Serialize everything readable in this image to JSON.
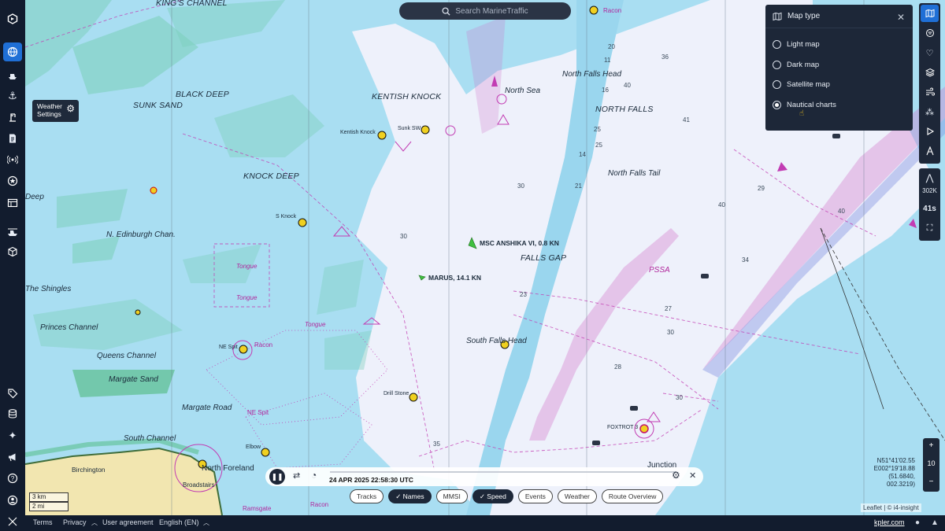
{
  "search": {
    "placeholder": "Search MarineTraffic"
  },
  "weather": {
    "line1": "Weather",
    "line2": "Settings"
  },
  "map_type": {
    "title": "Map type",
    "options": [
      {
        "label": "Light map",
        "selected": false
      },
      {
        "label": "Dark map",
        "selected": false
      },
      {
        "label": "Satellite map",
        "selected": false
      },
      {
        "label": "Nautical charts",
        "selected": true
      }
    ]
  },
  "map_labels": {
    "kings_channel": "KING'S CHANNEL",
    "black_deep": "BLACK DEEP",
    "sunk_sand": "SUNK SAND",
    "kentish_knock": "KENTISH KNOCK",
    "knock_deep": "KNOCK DEEP",
    "edinburgh": "N. Edinburgh Chan.",
    "shingles": "The Shingles",
    "princes": "Princes Channel",
    "queens": "Queens Channel",
    "margate_sand": "Margate Sand",
    "margate_road": "Margate Road",
    "south_channel": "South Channel",
    "birchington": "Birchington",
    "north_foreland": "North Foreland",
    "north_sea": "North Sea",
    "nf_head": "North Falls Head",
    "north_falls": "NORTH FALLS",
    "nf_tail": "North Falls Tail",
    "falls_gap": "FALLS GAP",
    "sf_head": "South Falls Head",
    "pssa": "PSSA",
    "junction": "Junction",
    "deep": "Deep",
    "kentish_knock_buoy": "Kentish Knock",
    "sunk_sw": "Sunk SW",
    "s_knock": "S Knock",
    "ne_spit": "NE Spit",
    "drill_stone": "Drill Stone",
    "elbow": "Elbow",
    "racon": "Racon",
    "tongue": "Tongue",
    "foxtrot": "FOXTROT 3",
    "ramsgate": "Ramsgate",
    "broadstairs": "Broadstairs"
  },
  "vessels": [
    {
      "name": "MSC ANSHIKA VI, 0.8 KN",
      "color": "#3fbf3f"
    },
    {
      "name": "MARUS, 14.1 KN",
      "color": "#3fbf3f"
    }
  ],
  "depths": [
    "30",
    "30",
    "41",
    "40",
    "40",
    "29",
    "34",
    "35",
    "36",
    "27",
    "28",
    "25",
    "23",
    "20",
    "16",
    "14",
    "11",
    "21",
    "25",
    "30",
    "30",
    "40"
  ],
  "right_toolbar": {
    "count": "302K",
    "timer": "41s"
  },
  "zoom": {
    "plus": "+",
    "level": "10",
    "minus": "−"
  },
  "coords": {
    "lat": "N51°41'02.55",
    "lon": "E002°19'18.88",
    "decimal": "(51.6840, 002.3219)"
  },
  "scale": {
    "km": "3 km",
    "mi": "2 mi"
  },
  "playback": {
    "datetime": "24 APR 2025 22:58:30 UTC"
  },
  "chips": [
    {
      "label": "Tracks",
      "on": false
    },
    {
      "label": "Names",
      "on": true
    },
    {
      "label": "MMSI",
      "on": false
    },
    {
      "label": "Speed",
      "on": true
    },
    {
      "label": "Events",
      "on": false
    },
    {
      "label": "Weather",
      "on": false
    },
    {
      "label": "Route Overview",
      "on": false
    }
  ],
  "bottom": {
    "terms": "Terms",
    "privacy": "Privacy",
    "user_agreement": "User agreement",
    "language": "English (EN)",
    "site": "kpler.com"
  },
  "attribution": "Leaflet | © i4-insight"
}
